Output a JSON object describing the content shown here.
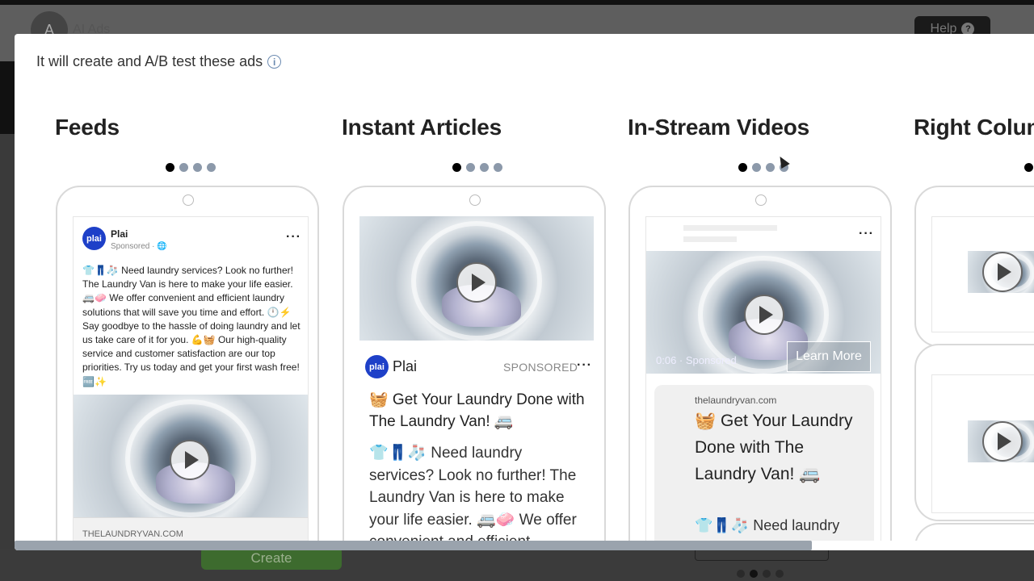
{
  "background": {
    "app_title": "AI Ads",
    "avatar_letter": "A",
    "help_label": "Help",
    "create_label": "Create"
  },
  "modal": {
    "heading": "It will create and A/B test these ads",
    "info_icon": "info-icon"
  },
  "sections": {
    "feeds": {
      "title": "Feeds",
      "brand": "Plai",
      "logo_text": "plai",
      "sponsored": "Sponsored · 🌐",
      "body": "👕👖🧦 Need laundry services? Look no further! The Laundry Van is here to make your life easier. 🚐🧼 We offer convenient and efficient laundry solutions that will save you time and effort. 🕛⚡ Say goodbye to the hassle of doing laundry and let us take care of it for you. 💪🧺 Our high-quality service and customer satisfaction are our top priorities. Try us today and get your first wash free! 🆓✨",
      "domain": "THELAUNDRYVAN.COM"
    },
    "instant_articles": {
      "title": "Instant Articles",
      "brand": "Plai",
      "logo_text": "plai",
      "sponsored": "SPONSORED",
      "headline": "🧺 Get Your Laundry Done with The Laundry Van! 🚐",
      "body": "👕👖🧦 Need laundry services? Look no further! The Laundry Van is here to make your life easier. 🚐🧼 We offer convenient and efficient"
    },
    "in_stream_videos": {
      "title": "In-Stream Videos",
      "timestamp": "0:06 · Sponsored",
      "learn_more": "Learn More",
      "domain": "thelaundryvan.com",
      "headline": "🧺 Get Your Laundry Done with The Laundry Van! 🚐",
      "body": "👕👖🧦 Need laundry"
    },
    "right_column": {
      "title": "Right Column"
    }
  },
  "carousel": {
    "dot_count": 4,
    "active_index": 0
  },
  "colors": {
    "plai_blue": "#1e40c8",
    "create_green": "#3d6b2e",
    "dot_inactive": "#8c99aa"
  }
}
